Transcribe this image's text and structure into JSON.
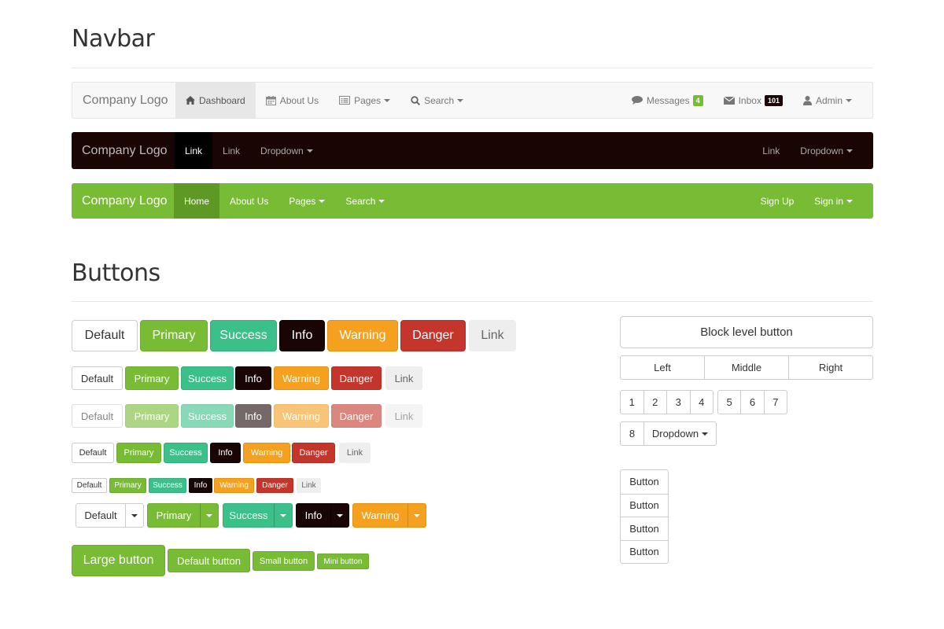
{
  "navbar_section": {
    "title": "Navbar"
  },
  "buttons_section": {
    "title": "Buttons"
  },
  "navbar_light": {
    "brand": "Company Logo",
    "left": [
      {
        "label": "Dashboard",
        "icon": "home-icon"
      },
      {
        "label": "About Us",
        "icon": "calendar-icon"
      },
      {
        "label": "Pages",
        "icon": "list-icon"
      },
      {
        "label": "Search",
        "icon": "search-icon"
      }
    ],
    "right": [
      {
        "label": "Messages",
        "icon": "comment-icon",
        "badge": "4",
        "badge_color": "#78bb34"
      },
      {
        "label": "Inbox",
        "icon": "envelope-icon",
        "badge": "101",
        "badge_color": "#1a0505"
      },
      {
        "label": "Admin",
        "icon": "user-icon"
      }
    ]
  },
  "navbar_dark": {
    "brand": "Company Logo",
    "left": [
      "Link",
      "Link",
      "Dropdown"
    ],
    "right": [
      "Link",
      "Dropdown"
    ]
  },
  "navbar_green": {
    "brand": "Company Logo",
    "left": [
      "Home",
      "About Us",
      "Pages",
      "Search"
    ],
    "right": [
      "Sign Up",
      "Sign in"
    ]
  },
  "buttons": {
    "labels": [
      "Default",
      "Primary",
      "Success",
      "Info",
      "Warning",
      "Danger",
      "Link"
    ],
    "split_labels": [
      "Default",
      "Primary",
      "Success",
      "Info",
      "Warning"
    ],
    "sizes": [
      "Large button",
      "Default button",
      "Small button",
      "Mini button"
    ],
    "block": "Block level button",
    "justified": [
      "Left",
      "Middle",
      "Right"
    ],
    "toolbar1": [
      "1",
      "2",
      "3",
      "4"
    ],
    "toolbar2": [
      "5",
      "6",
      "7"
    ],
    "toolbar3": "8",
    "toolbar_dropdown": "Dropdown",
    "vertical": [
      "Button",
      "Button",
      "Button",
      "Button"
    ]
  },
  "colors": {
    "primary": "#78bb34",
    "success": "#3cc089",
    "info": "#1a0505",
    "warning": "#f5a01f",
    "danger": "#c4362b"
  }
}
